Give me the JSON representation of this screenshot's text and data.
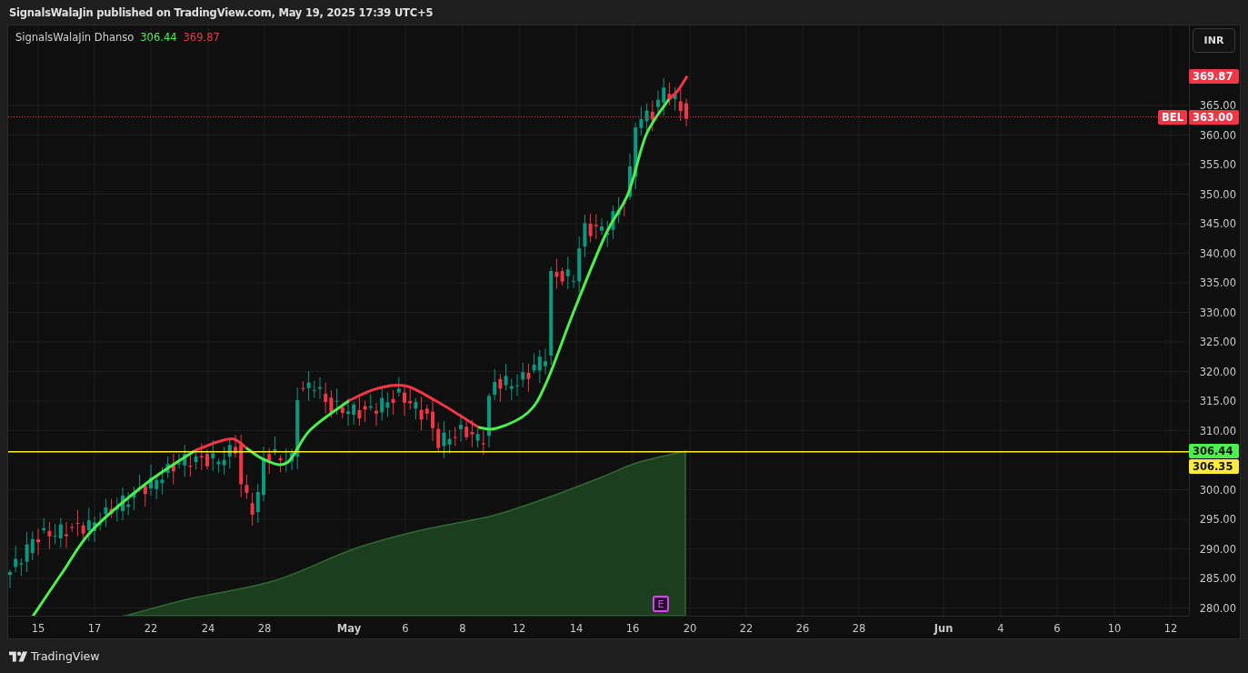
{
  "header": {
    "text": "SignalsWalaJin published on TradingView.com, May 19, 2025 17:39 UTC+5"
  },
  "legend": {
    "title": "SignalsWalaJin Dhanso",
    "values": [
      {
        "text": "306.44",
        "color": "#4cf04c"
      },
      {
        "text": "369.87",
        "color": "#f23645"
      }
    ]
  },
  "currency_button": "INR",
  "price_labels": [
    {
      "text": "369.87",
      "color": "#f23645"
    },
    {
      "symbol": "BEL",
      "text": "363.00",
      "color": "#f23645"
    },
    {
      "text": "306.44",
      "color": "#4cf04c"
    },
    {
      "text": "306.35",
      "color": "#ffeb3b"
    }
  ],
  "y_axis": [
    "365.00",
    "360.00",
    "355.00",
    "350.00",
    "345.00",
    "340.00",
    "335.00",
    "330.00",
    "325.00",
    "320.00",
    "315.00",
    "310.00",
    "300.00",
    "295.00",
    "290.00",
    "285.00",
    "280.00"
  ],
  "x_axis": [
    {
      "label": "15",
      "bold": false
    },
    {
      "label": "17",
      "bold": false
    },
    {
      "label": "22",
      "bold": false
    },
    {
      "label": "24",
      "bold": false
    },
    {
      "label": "28",
      "bold": false
    },
    {
      "label": "May",
      "bold": true
    },
    {
      "label": "6",
      "bold": false
    },
    {
      "label": "8",
      "bold": false
    },
    {
      "label": "12",
      "bold": false
    },
    {
      "label": "14",
      "bold": false
    },
    {
      "label": "16",
      "bold": false
    },
    {
      "label": "20",
      "bold": false
    },
    {
      "label": "22",
      "bold": false
    },
    {
      "label": "26",
      "bold": false
    },
    {
      "label": "28",
      "bold": false
    },
    {
      "label": "Jun",
      "bold": true
    },
    {
      "label": "4",
      "bold": false
    },
    {
      "label": "6",
      "bold": false
    },
    {
      "label": "10",
      "bold": false
    },
    {
      "label": "12",
      "bold": false
    }
  ],
  "event_marker": "E",
  "footer": {
    "brand": "TradingView"
  }
}
